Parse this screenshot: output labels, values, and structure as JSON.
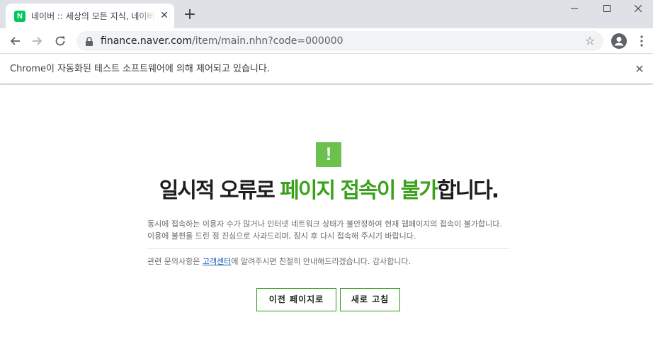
{
  "browser": {
    "tab": {
      "favicon_letter": "N",
      "title": "네이버 :: 세상의 모든 지식, 네이버",
      "close_glyph": "✕"
    },
    "new_tab_glyph": "+",
    "address": {
      "host": "finance.naver.com",
      "path": "/item/main.nhn?code=000000"
    },
    "star_glyph": "☆",
    "infobar": {
      "text": "Chrome이 자동화된 테스트 소프트웨어에 의해 제어되고 있습니다.",
      "close_glyph": "✕"
    }
  },
  "error_page": {
    "icon_glyph": "!",
    "title_plain_1": "일시적 오류로 ",
    "title_highlight": "페이지 접속이 불가",
    "title_plain_2": "합니다.",
    "description_line_1": "동시에 접속하는 이용자 수가 많거나 인터넷 네트워크 상태가 불안정하여 현재 웹페이지의 접속이 불가합니다.",
    "description_line_2": "이용에 불편을 드린 점 진심으로 사과드리며, 잠시 후 다시 접속해 주시기 바랍니다.",
    "contact_prefix": "관련 문의사항은 ",
    "contact_link": "고객센터",
    "contact_suffix": "에 알려주시면 친절히 안내해드리겠습니다. 감사합니다.",
    "buttons": {
      "previous": "이전 페이지로",
      "reload": "새로 고침"
    }
  },
  "colors": {
    "accent_green": "#3aa11a",
    "icon_green": "#6cc14e",
    "naver_green": "#03c75a",
    "link_blue": "#1c5fb4"
  },
  "icons": [
    "naver-favicon-icon",
    "close-icon",
    "plus-icon",
    "minimize-icon",
    "maximize-icon",
    "back-arrow-icon",
    "forward-arrow-icon",
    "reload-icon",
    "lock-icon",
    "star-icon",
    "profile-icon",
    "kebab-menu-icon",
    "exclamation-icon"
  ]
}
